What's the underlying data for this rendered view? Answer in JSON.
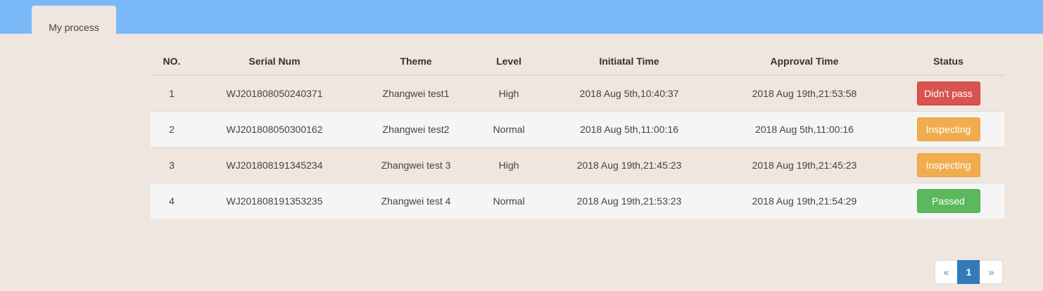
{
  "header": {
    "tabs": [
      {
        "label": "My process"
      }
    ]
  },
  "table": {
    "columns": [
      "NO.",
      "Serial Num",
      "Theme",
      "Level",
      "Initiatal Time",
      "Approval Time",
      "Status"
    ],
    "rows": [
      {
        "no": "1",
        "serial": "WJ201808050240371",
        "theme": "Zhangwei test1",
        "level": "High",
        "initiated": "2018 Aug 5th,10:40:37",
        "approval": "2018 Aug 19th,21:53:58",
        "status": "Didn't pass",
        "status_color": "#d9534f",
        "status_border": "#d43f3a"
      },
      {
        "no": "2",
        "serial": "WJ201808050300162",
        "theme": "Zhangwei test2",
        "level": "Normal",
        "initiated": "2018 Aug 5th,11:00:16",
        "approval": "2018 Aug 5th,11:00:16",
        "status": "Inspecting",
        "status_color": "#f0ad4e",
        "status_border": "#eea236"
      },
      {
        "no": "3",
        "serial": "WJ201808191345234",
        "theme": "Zhangwei test 3",
        "level": "High",
        "initiated": "2018 Aug 19th,21:45:23",
        "approval": "2018 Aug 19th,21:45:23",
        "status": "Inspecting",
        "status_color": "#f0ad4e",
        "status_border": "#eea236"
      },
      {
        "no": "4",
        "serial": "WJ201808191353235",
        "theme": "Zhangwei test 4",
        "level": "Normal",
        "initiated": "2018 Aug 19th,21:53:23",
        "approval": "2018 Aug 19th,21:54:29",
        "status": "Passed",
        "status_color": "#5cb85c",
        "status_border": "#4cae4c"
      }
    ]
  },
  "pagination": {
    "prev": "«",
    "pages": [
      "1"
    ],
    "current": "1",
    "next": "»"
  },
  "colors": {
    "topbar": "#7ab9f7",
    "background": "#efe6df",
    "accent": "#337ab7"
  }
}
